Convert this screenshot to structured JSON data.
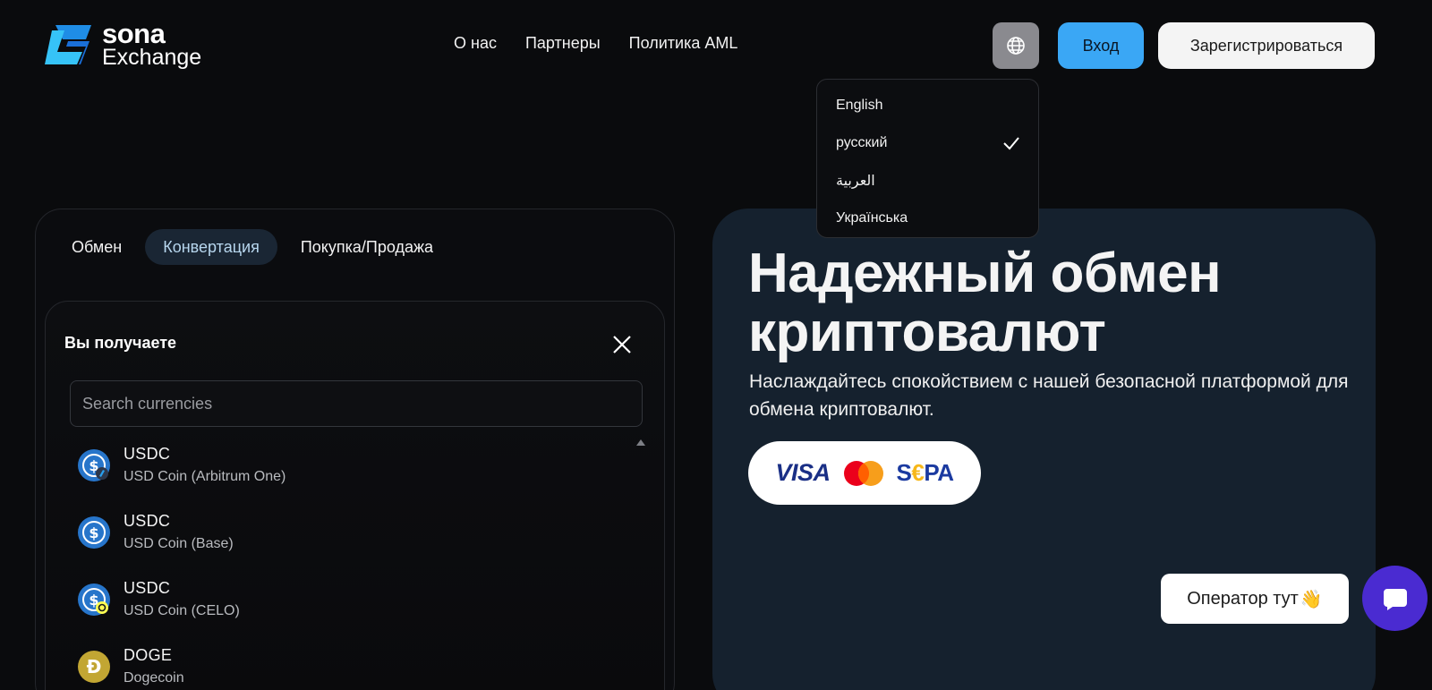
{
  "header": {
    "logo": {
      "name": "sona",
      "sub": "Exchange"
    },
    "nav": [
      {
        "label": "О нас"
      },
      {
        "label": "Партнеры"
      },
      {
        "label": "Политика AML"
      }
    ],
    "login_label": "Вход",
    "register_label": "Зарегистрироваться"
  },
  "language_menu": {
    "items": [
      {
        "label": "English",
        "selected": false
      },
      {
        "label": "русский",
        "selected": true
      },
      {
        "label": "العربية",
        "selected": false
      },
      {
        "label": "Українська",
        "selected": false
      }
    ]
  },
  "exchange": {
    "tabs": [
      {
        "label": "Обмен",
        "active": false
      },
      {
        "label": "Конвертация",
        "active": true
      },
      {
        "label": "Покупка/Продажа",
        "active": false
      }
    ],
    "receive_title": "Вы получаете",
    "search_placeholder": "Search currencies",
    "currencies": [
      {
        "symbol": "USDC",
        "name": "USD Coin (Arbitrum One)",
        "icon": "usdc-arbitrum-icon"
      },
      {
        "symbol": "USDC",
        "name": "USD Coin (Base)",
        "icon": "usdc-base-icon"
      },
      {
        "symbol": "USDC",
        "name": "USD Coin (CELO)",
        "icon": "usdc-celo-icon"
      },
      {
        "symbol": "DOGE",
        "name": "Dogecoin",
        "icon": "dogecoin-icon"
      }
    ]
  },
  "hero": {
    "title_line1": "Надежный обмен",
    "title_line2": "криптовалют",
    "subtitle": "Наслаждайтесь спокойствием с нашей безопасной платформой для обмена криптовалют.",
    "payments": {
      "visa": "VISA",
      "sepa_s": "S",
      "sepa_e": "€",
      "sepa_rest": "PA"
    }
  },
  "support": {
    "operator_label": "Оператор тут",
    "wave_emoji": "👋"
  },
  "colors": {
    "accent_blue": "#3aa7f5",
    "hero_bg": "#15212e",
    "chat_purple": "#4a2bd1"
  }
}
